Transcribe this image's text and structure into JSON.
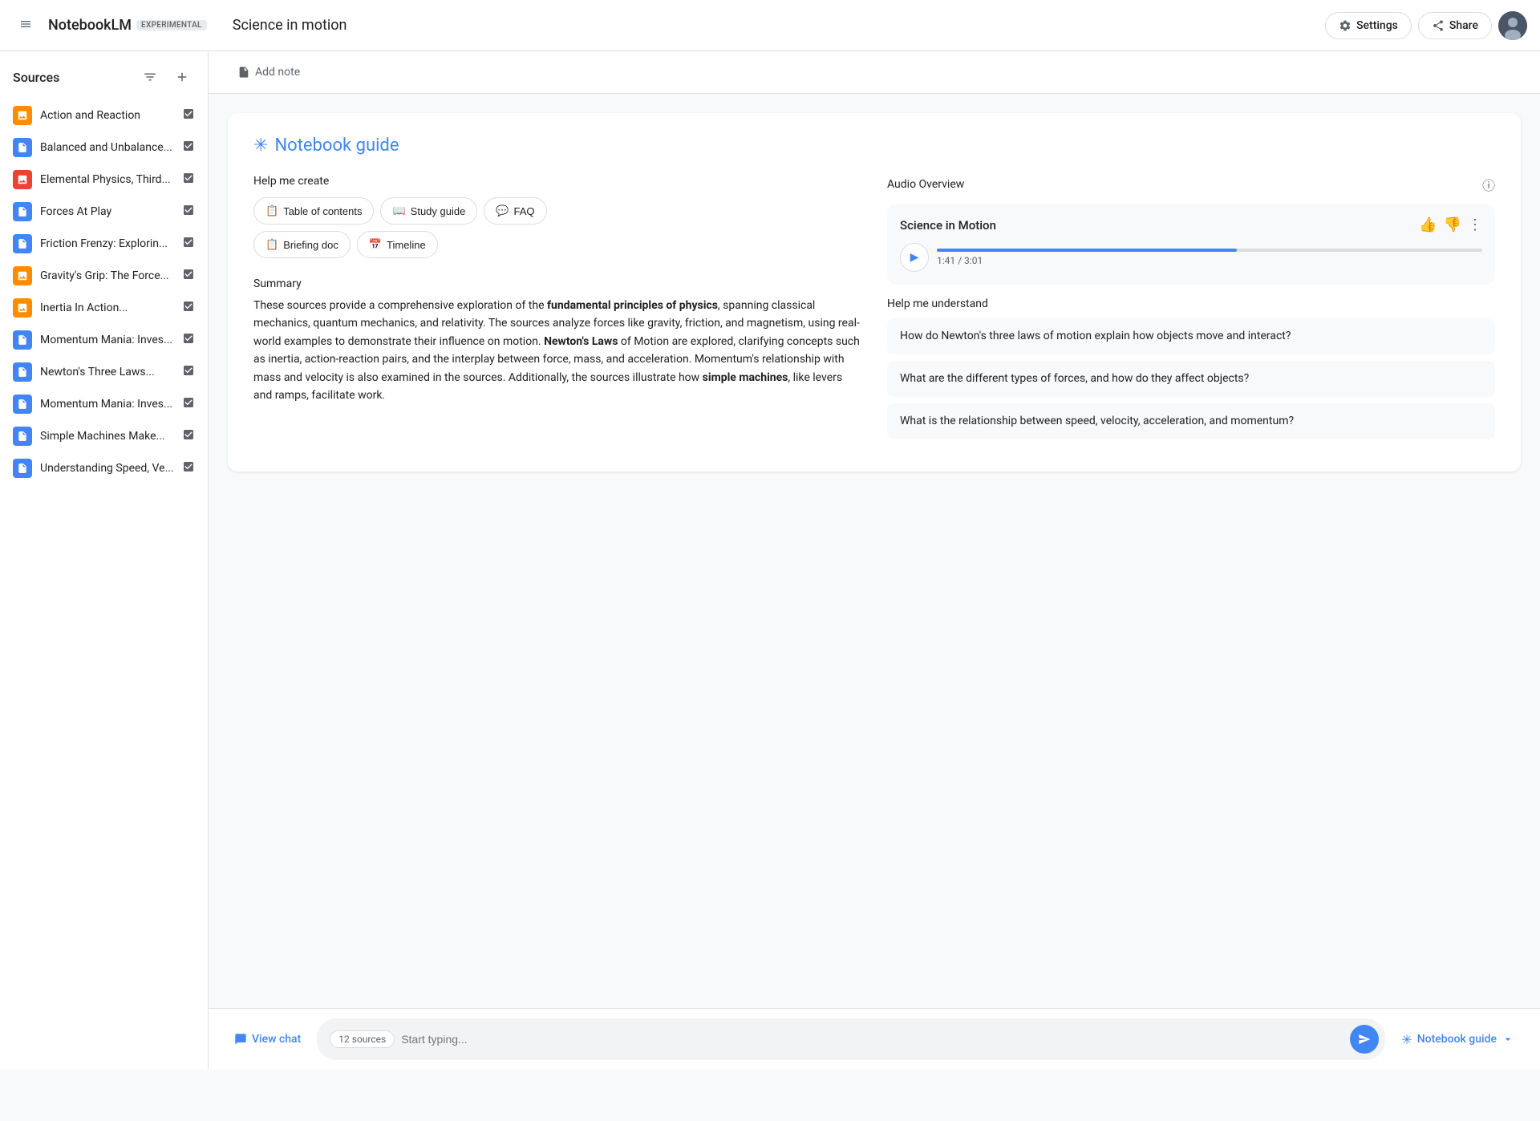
{
  "header": {
    "menu_label": "Menu",
    "logo": "NotebookLM",
    "experimental_badge": "EXPERIMENTAL",
    "notebook_title": "Science in motion",
    "settings_label": "Settings",
    "share_label": "Share"
  },
  "sidebar": {
    "title": "Sources",
    "filter_icon": "filter-icon",
    "add_icon": "add-icon",
    "sources": [
      {
        "id": 1,
        "label": "Action and Reaction",
        "icon_type": "orange",
        "icon_char": "▪",
        "checked": true
      },
      {
        "id": 2,
        "label": "Balanced and Unbalance...",
        "icon_type": "blue",
        "icon_char": "≡",
        "checked": true
      },
      {
        "id": 3,
        "label": "Elemental Physics, Third...",
        "icon_type": "red",
        "icon_char": "▪",
        "checked": true
      },
      {
        "id": 4,
        "label": "Forces At Play",
        "icon_type": "blue",
        "icon_char": "≡",
        "checked": true
      },
      {
        "id": 5,
        "label": "Friction Frenzy: Explorin...",
        "icon_type": "blue",
        "icon_char": "≡",
        "checked": true
      },
      {
        "id": 6,
        "label": "Gravity's Grip: The Force...",
        "icon_type": "orange",
        "icon_char": "▪",
        "checked": true
      },
      {
        "id": 7,
        "label": "Inertia In Action...",
        "icon_type": "orange",
        "icon_char": "▪",
        "checked": true
      },
      {
        "id": 8,
        "label": "Momentum Mania: Inves...",
        "icon_type": "blue",
        "icon_char": "≡",
        "checked": true
      },
      {
        "id": 9,
        "label": "Newton's Three Laws...",
        "icon_type": "blue",
        "icon_char": "≡",
        "checked": true
      },
      {
        "id": 10,
        "label": "Momentum Mania: Inves...",
        "icon_type": "blue",
        "icon_char": "≡",
        "checked": true
      },
      {
        "id": 11,
        "label": "Simple Machines Make...",
        "icon_type": "blue",
        "icon_char": "≡",
        "checked": true
      },
      {
        "id": 12,
        "label": "Understanding Speed, Ve...",
        "icon_type": "blue",
        "icon_char": "≡",
        "checked": true
      }
    ]
  },
  "toolbar": {
    "add_note_label": "Add note"
  },
  "guide_card": {
    "star_icon": "✳",
    "title": "Notebook guide",
    "help_me_create_label": "Help me create",
    "buttons": [
      {
        "id": "toc",
        "icon": "📋",
        "label": "Table of contents"
      },
      {
        "id": "study",
        "icon": "📖",
        "label": "Study guide"
      },
      {
        "id": "faq",
        "icon": "💬",
        "label": "FAQ"
      },
      {
        "id": "briefing",
        "icon": "📋",
        "label": "Briefing doc"
      },
      {
        "id": "timeline",
        "icon": "📅",
        "label": "Timeline"
      }
    ],
    "summary_label": "Summary",
    "summary_text_1": "These sources provide a comprehensive exploration of the ",
    "summary_bold_1": "fundamental principles of physics",
    "summary_text_2": ", spanning classical mechanics, quantum mechanics, and relativity. The sources analyze forces like gravity, friction, and magnetism, using real-world examples to demonstrate their influence on motion. ",
    "summary_bold_2": "Newton's Laws",
    "summary_text_3": " of Motion are explored, clarifying concepts such as inertia, action-reaction pairs, and the interplay between force, mass, and acceleration. Momentum's relationship with mass and velocity is also examined in the sources. Additionally, the sources illustrate how ",
    "summary_bold_3": "simple machines",
    "summary_text_4": ", like levers and ramps, facilitate work.",
    "audio_overview_label": "Audio Overview",
    "audio_card_title": "Science in Motion",
    "audio_time": "1:41 / 3:01",
    "audio_progress_pct": 55,
    "help_me_understand_label": "Help me understand",
    "understand_items": [
      {
        "id": 1,
        "text": "How do Newton's three laws of motion explain how objects move and interact?"
      },
      {
        "id": 2,
        "text": "What are the different types of forces, and how do they affect objects?"
      },
      {
        "id": 3,
        "text": "What is the relationship between speed, velocity, acceleration, and momentum?"
      }
    ]
  },
  "bottom_bar": {
    "view_chat_label": "View chat",
    "sources_badge": "12 sources",
    "input_placeholder": "Start typing...",
    "notebook_guide_label": "Notebook guide"
  }
}
